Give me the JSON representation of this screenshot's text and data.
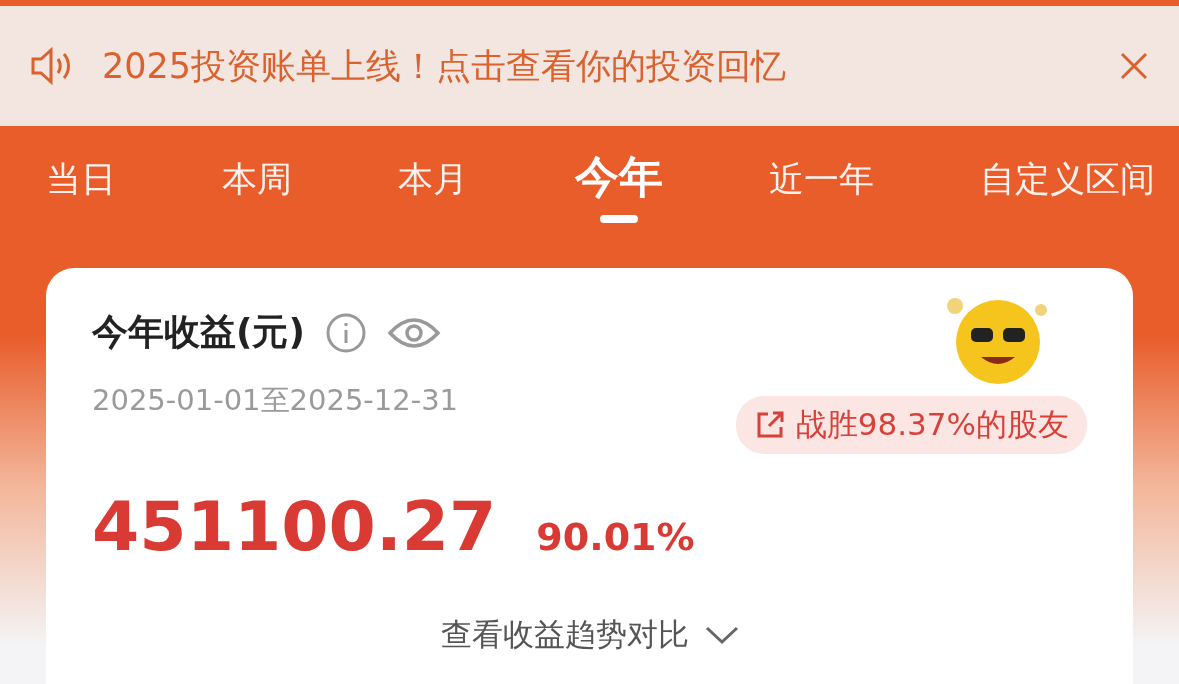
{
  "banner": {
    "text": "2025投资账单上线！点击查看你的投资回忆"
  },
  "tabs": [
    {
      "label": "当日",
      "selected": false
    },
    {
      "label": "本周",
      "selected": false
    },
    {
      "label": "本月",
      "selected": false
    },
    {
      "label": "今年",
      "selected": true
    },
    {
      "label": "近一年",
      "selected": false
    },
    {
      "label": "自定义区间",
      "selected": false
    }
  ],
  "card": {
    "title": "今年收益(元)",
    "date_range": "2025-01-01至2025-12-31",
    "badge": "战胜98.37%的股友",
    "amount": "451100.27",
    "rate": "90.01%",
    "trend_link": "查看收益趋势对比"
  }
}
